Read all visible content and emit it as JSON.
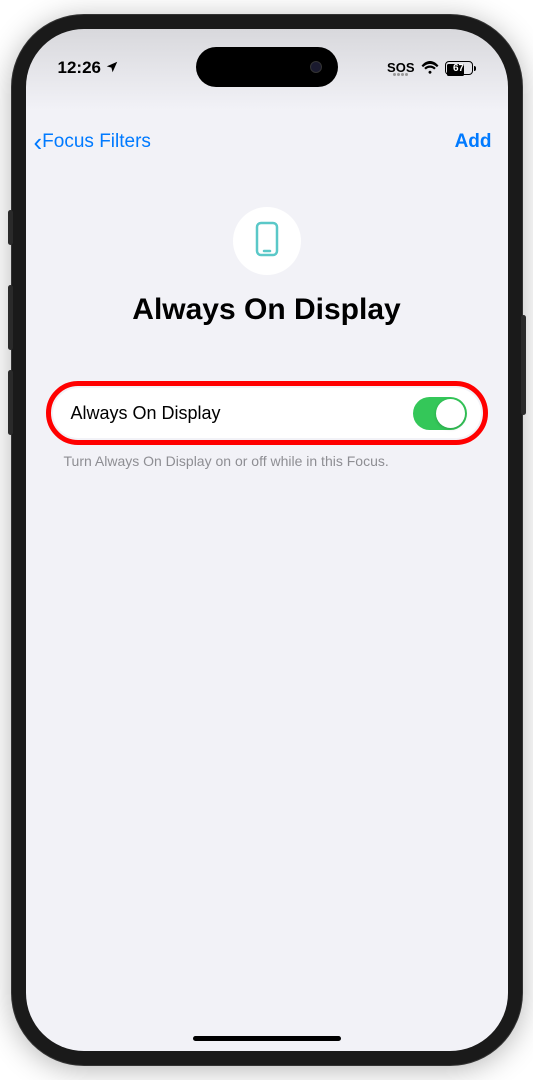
{
  "statusBar": {
    "time": "12:26",
    "sos": "SOS",
    "batteryLevel": "67"
  },
  "nav": {
    "backLabel": "Focus Filters",
    "addLabel": "Add"
  },
  "page": {
    "title": "Always On Display"
  },
  "setting": {
    "label": "Always On Display",
    "enabled": true,
    "description": "Turn Always On Display on or off while in this Focus."
  }
}
